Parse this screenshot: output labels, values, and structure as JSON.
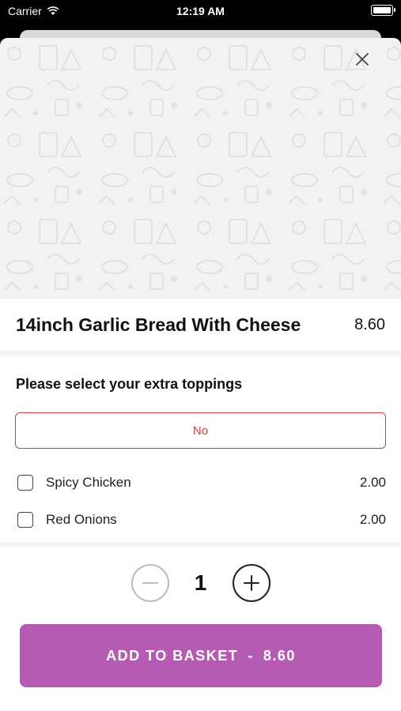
{
  "status_bar": {
    "carrier": "Carrier",
    "time": "12:19 AM"
  },
  "item": {
    "title": "14inch Garlic Bread With Cheese",
    "price": "8.60"
  },
  "toppings_section": {
    "title": "Please select your extra toppings",
    "selected_option": "No",
    "options": [
      {
        "name": "Spicy Chicken",
        "price": "2.00",
        "checked": false
      },
      {
        "name": "Red Onions",
        "price": "2.00",
        "checked": false
      }
    ]
  },
  "quantity": {
    "value": "1"
  },
  "add_button": {
    "label": "ADD TO BASKET",
    "separator": "-",
    "price": "8.60"
  },
  "colors": {
    "accent": "#b65bb3",
    "option_border": "#d33c3c"
  }
}
